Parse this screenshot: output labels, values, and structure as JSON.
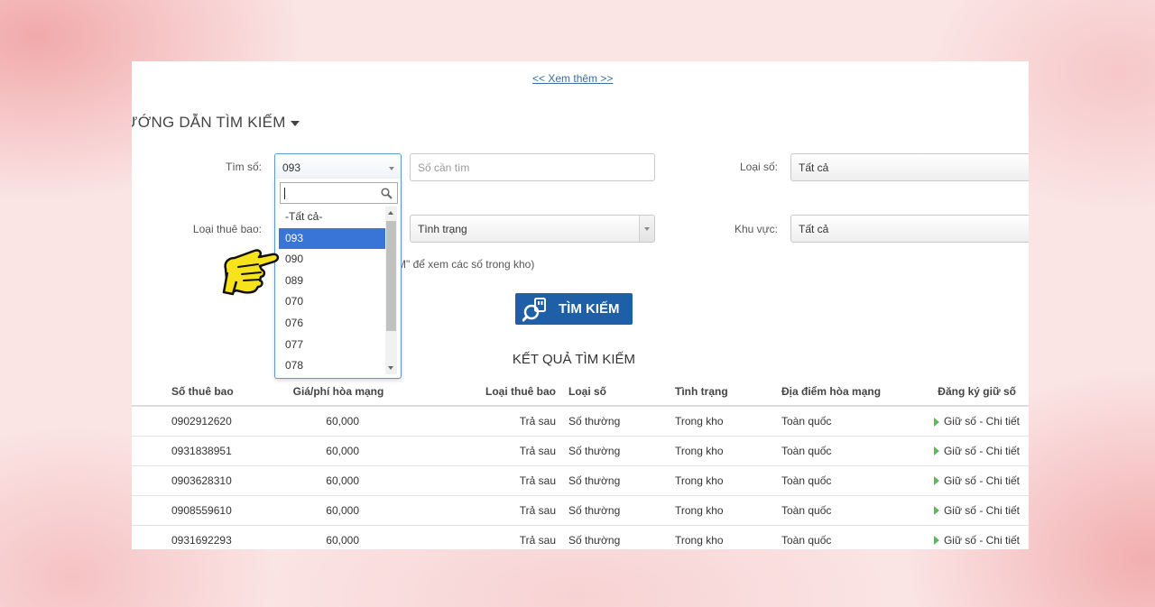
{
  "top": {
    "see_more": "<< Xem thêm >>"
  },
  "guide": {
    "title": "ƯỚNG DẪN TÌM KIẾM"
  },
  "form": {
    "tim_so_label": "Tìm số:",
    "tim_so_value": "093",
    "so_can_tim_placeholder": "Số cần tìm",
    "loai_so_label": "Loại số:",
    "loai_so_value": "Tất cả",
    "loai_thue_bao_label": "Loại thuê bao:",
    "tinh_trang_value": "Tình trạng",
    "khu_vuc_label": "Khu vực:",
    "khu_vuc_value": "Tất cả",
    "hint": "M\" để xem các số trong kho)"
  },
  "dropdown": {
    "search_value": "",
    "options": [
      "-Tất cả-",
      "093",
      "090",
      "089",
      "070",
      "076",
      "077",
      "078"
    ],
    "selected_index": 1
  },
  "search_button": {
    "label": "TÌM KIẾM"
  },
  "results": {
    "title": "KẾT QUẢ TÌM KIẾM",
    "columns": [
      "Số thuê bao",
      "Giá/phí hòa mạng",
      "Loại thuê bao",
      "Loại số",
      "Tình trạng",
      "Địa điểm hòa mạng",
      "Đăng ký giữ số"
    ],
    "rows": [
      {
        "number": "0902912620",
        "price": "60,000",
        "type": "Trả sau",
        "kind": "Số thường",
        "status": "Trong kho",
        "location": "Toàn quốc",
        "action": "Giữ số - Chi tiết"
      },
      {
        "number": "0931838951",
        "price": "60,000",
        "type": "Trả sau",
        "kind": "Số thường",
        "status": "Trong kho",
        "location": "Toàn quốc",
        "action": "Giữ số - Chi tiết"
      },
      {
        "number": "0903628310",
        "price": "60,000",
        "type": "Trả sau",
        "kind": "Số thường",
        "status": "Trong kho",
        "location": "Toàn quốc",
        "action": "Giữ số - Chi tiết"
      },
      {
        "number": "0908559610",
        "price": "60,000",
        "type": "Trả sau",
        "kind": "Số thường",
        "status": "Trong kho",
        "location": "Toàn quốc",
        "action": "Giữ số - Chi tiết"
      },
      {
        "number": "0931692293",
        "price": "60,000",
        "type": "Trả sau",
        "kind": "Số thường",
        "status": "Trong kho",
        "location": "Toàn quốc",
        "action": "Giữ số - Chi tiết"
      }
    ]
  },
  "colors": {
    "accent": "#1f5fa8",
    "link": "#3a6ea5",
    "selected": "#3875d7",
    "arrow": "#5cb85c"
  }
}
